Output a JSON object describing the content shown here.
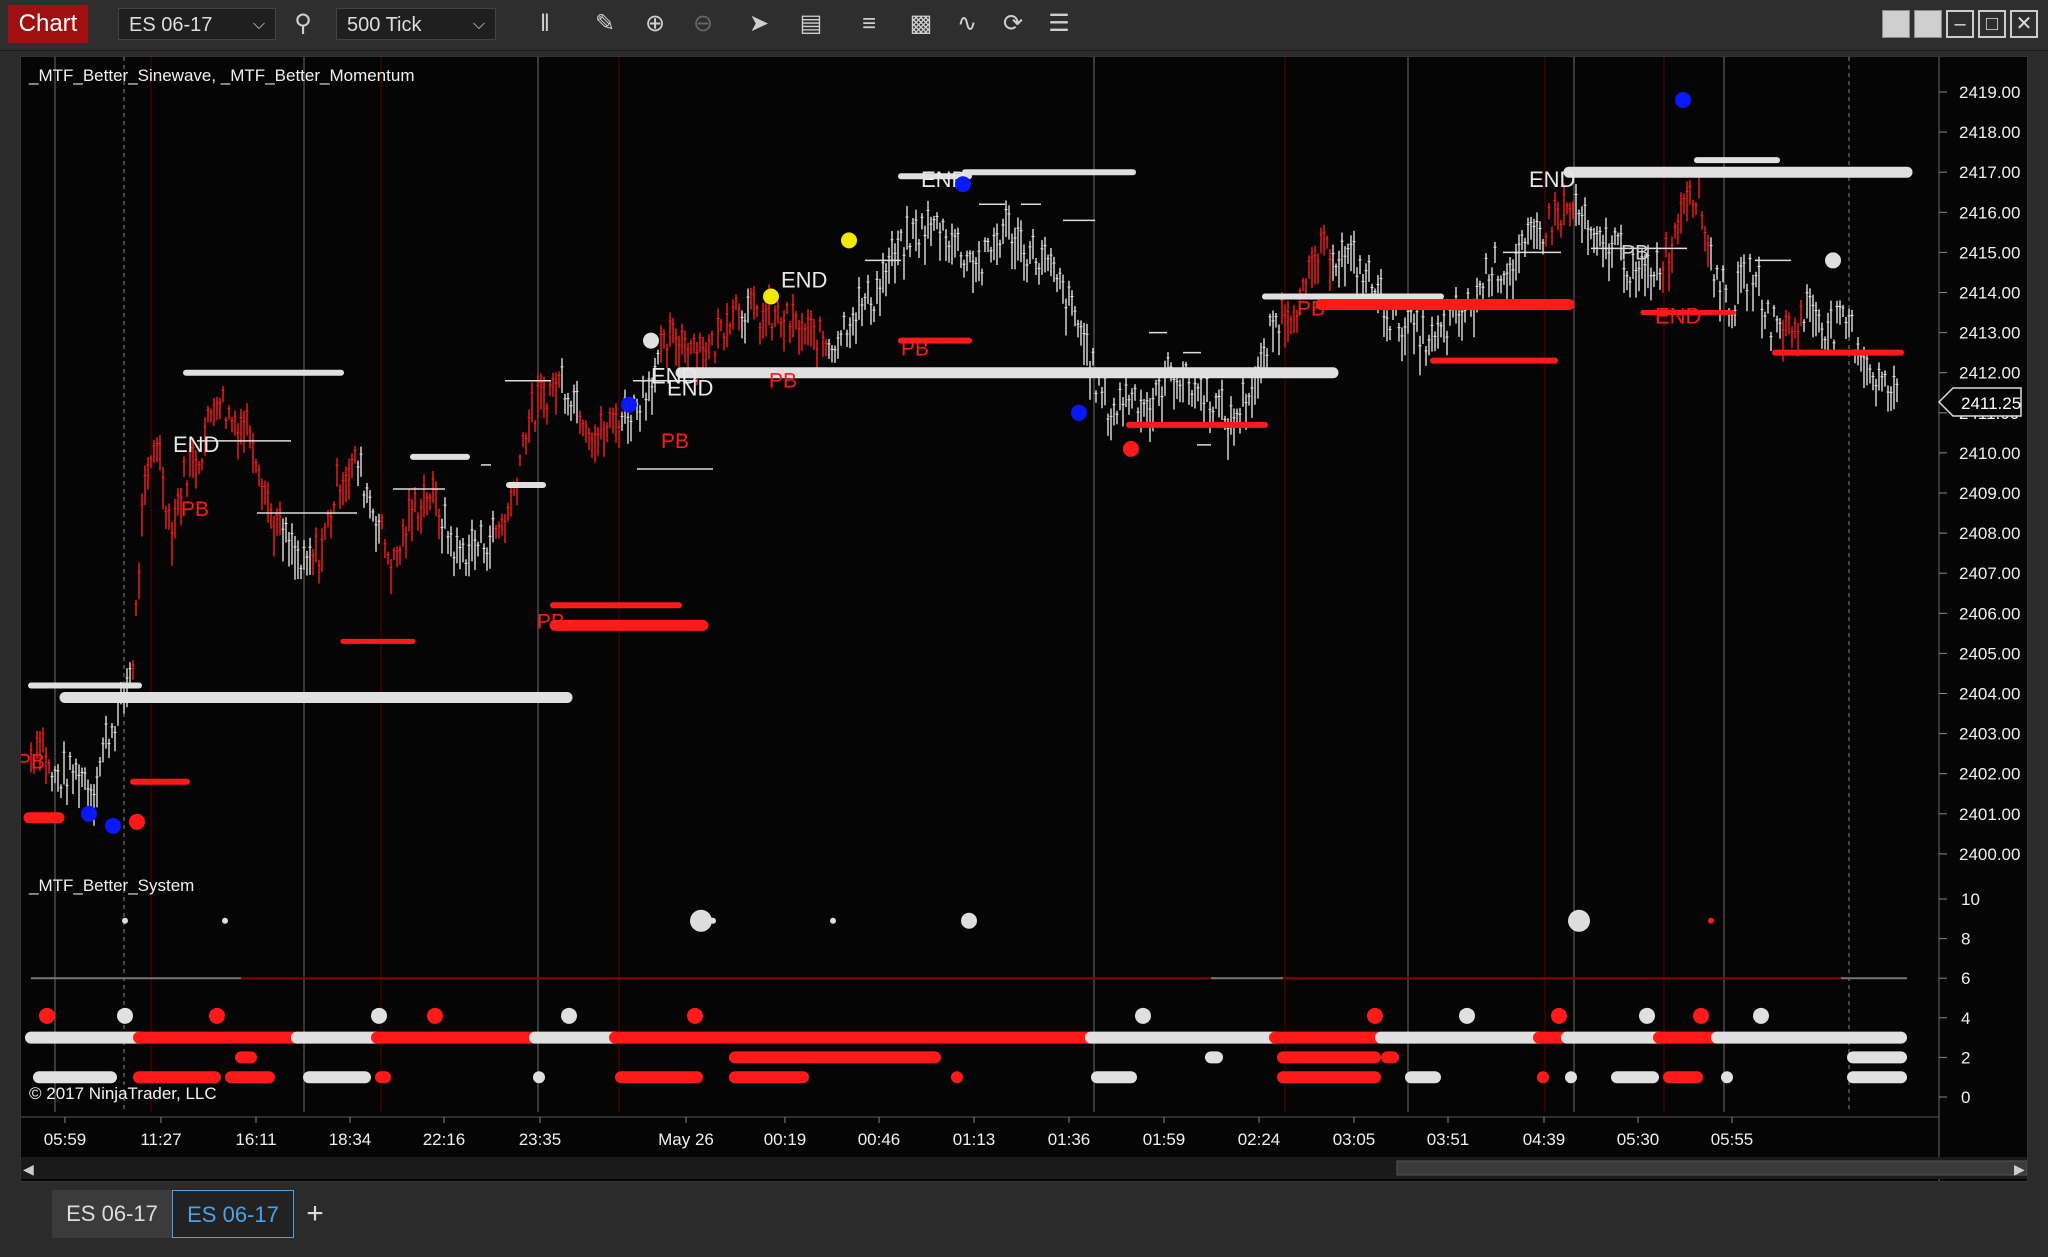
{
  "toolbar": {
    "chart_label": "Chart",
    "instrument": "ES 06-17",
    "interval": "500 Tick",
    "icons": [
      "search-icon",
      "bar-type-icon",
      "pencil-icon",
      "zoom-in-icon",
      "zoom-out-icon",
      "pointer-icon",
      "data-box-icon",
      "chart-trader-icon",
      "properties-icon",
      "strategies-icon",
      "reload-icon",
      "indicators-list-icon"
    ],
    "window_buttons": [
      "tile-icon",
      "tile2-icon",
      "minimize-icon",
      "maximize-icon",
      "close-icon"
    ]
  },
  "panel_top": {
    "indicator_label": "_MTF_Better_Sinewave, _MTF_Better_Momentum",
    "price_ticks": [
      "2419.00",
      "2418.00",
      "2417.00",
      "2416.00",
      "2415.00",
      "2414.00",
      "2413.00",
      "2412.00",
      "2411.00",
      "2410.00",
      "2409.00",
      "2408.00",
      "2407.00",
      "2406.00",
      "2405.00",
      "2404.00",
      "2403.00",
      "2402.00",
      "2401.00",
      "2400.00"
    ],
    "current_price": "2411.25",
    "end_label": "END",
    "pb_label": "PB"
  },
  "panel_bottom": {
    "indicator_label": "_MTF_Better_System",
    "ticks": [
      "10",
      "8",
      "6",
      "4",
      "2",
      "0"
    ],
    "copyright": "© 2017 NinjaTrader, LLC"
  },
  "time_axis": [
    "05:59",
    "11:27",
    "16:11",
    "18:34",
    "22:16",
    "23:35",
    "May 26",
    "00:19",
    "00:46",
    "01:13",
    "01:36",
    "01:59",
    "02:24",
    "03:05",
    "03:51",
    "04:39",
    "05:30",
    "05:55"
  ],
  "colors": {
    "up": "#e0e0e0",
    "down": "#ff1a1a",
    "blue": "#0a18ff",
    "yellow": "#f0e800",
    "bg": "#050505"
  },
  "tabs": [
    {
      "label": "ES 06-17",
      "active": false
    },
    {
      "label": "ES 06-17",
      "active": true
    }
  ],
  "add_tab": "+"
}
